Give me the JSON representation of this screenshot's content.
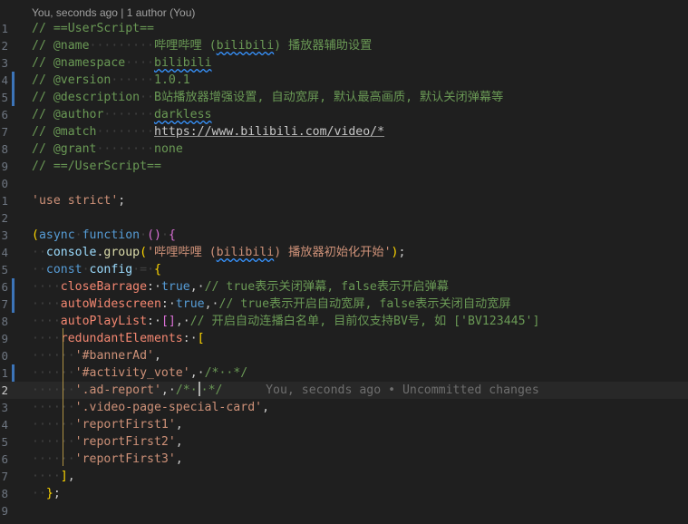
{
  "blame_header": "You, seconds ago | 1 author (You)",
  "inline_blame": "You, seconds ago • Uncommitted changes",
  "lines": [
    {
      "num": "1",
      "modified": false,
      "tokens": [
        [
          "// ",
          "c-comment"
        ],
        [
          "==UserScript==",
          "c-comment"
        ]
      ]
    },
    {
      "num": "2",
      "modified": false,
      "tokens": [
        [
          "// ",
          "c-comment"
        ],
        [
          "@name",
          "c-comment"
        ],
        [
          "·········",
          "ws"
        ],
        [
          "哔哩哔哩 (",
          "c-comment"
        ],
        [
          "bilibili",
          "c-comment squig"
        ],
        [
          ") 播放器辅助设置",
          "c-comment"
        ]
      ]
    },
    {
      "num": "3",
      "modified": false,
      "tokens": [
        [
          "// ",
          "c-comment"
        ],
        [
          "@namespace",
          "c-comment"
        ],
        [
          "····",
          "ws"
        ],
        [
          "bilibili",
          "c-comment squig"
        ]
      ]
    },
    {
      "num": "4",
      "modified": true,
      "tokens": [
        [
          "// ",
          "c-comment"
        ],
        [
          "@version",
          "c-comment"
        ],
        [
          "······",
          "ws"
        ],
        [
          "1.0.1",
          "c-comment"
        ]
      ]
    },
    {
      "num": "5",
      "modified": true,
      "tokens": [
        [
          "// ",
          "c-comment"
        ],
        [
          "@description",
          "c-comment"
        ],
        [
          "··",
          "ws"
        ],
        [
          "B站播放器增强设置, 自动宽屏, 默认最高画质, 默认关闭弹幕等",
          "c-comment"
        ]
      ]
    },
    {
      "num": "6",
      "modified": false,
      "tokens": [
        [
          "// ",
          "c-comment"
        ],
        [
          "@author",
          "c-comment"
        ],
        [
          "·······",
          "ws"
        ],
        [
          "darkless",
          "c-comment squig"
        ]
      ]
    },
    {
      "num": "7",
      "modified": false,
      "tokens": [
        [
          "// ",
          "c-comment"
        ],
        [
          "@match",
          "c-comment"
        ],
        [
          "········",
          "ws"
        ],
        [
          "https://www.bilibili.com/video/*",
          "c-url"
        ]
      ]
    },
    {
      "num": "8",
      "modified": false,
      "tokens": [
        [
          "// ",
          "c-comment"
        ],
        [
          "@grant",
          "c-comment"
        ],
        [
          "········",
          "ws"
        ],
        [
          "none",
          "c-comment"
        ]
      ]
    },
    {
      "num": "9",
      "modified": false,
      "tokens": [
        [
          "// ",
          "c-comment"
        ],
        [
          "==/UserScript==",
          "c-comment"
        ]
      ]
    },
    {
      "num": "0",
      "modified": false,
      "tokens": []
    },
    {
      "num": "1",
      "modified": false,
      "tokens": [
        [
          "'use strict'",
          "c-string"
        ],
        [
          ";",
          "c-plain"
        ]
      ]
    },
    {
      "num": "2",
      "modified": false,
      "tokens": []
    },
    {
      "num": "3",
      "modified": false,
      "tokens": [
        [
          "(",
          "c-brace"
        ],
        [
          "async",
          "c-keyword"
        ],
        [
          "·",
          "ws"
        ],
        [
          "function",
          "c-keyword"
        ],
        [
          "·",
          "ws"
        ],
        [
          "()",
          "c-bracket"
        ],
        [
          "·",
          "ws"
        ],
        [
          "{",
          "c-bracket"
        ]
      ]
    },
    {
      "num": "4",
      "modified": false,
      "tokens": [
        [
          "··",
          "ws"
        ],
        [
          "console",
          "c-ident"
        ],
        [
          ".",
          "c-plain"
        ],
        [
          "group",
          "c-func"
        ],
        [
          "(",
          "c-brace"
        ],
        [
          "'哔哩哔哩 (",
          "c-string"
        ],
        [
          "bilibili",
          "c-string squig"
        ],
        [
          ") 播放器初始化开始'",
          "c-string"
        ],
        [
          ")",
          "c-brace"
        ],
        [
          ";",
          "c-plain"
        ]
      ]
    },
    {
      "num": "5",
      "modified": false,
      "tokens": [
        [
          "··",
          "ws"
        ],
        [
          "const",
          "c-keyword"
        ],
        [
          "·",
          "ws"
        ],
        [
          "config",
          "c-ident"
        ],
        [
          "·=·",
          "ws"
        ],
        [
          "{",
          "c-brace"
        ]
      ]
    },
    {
      "num": "6",
      "modified": true,
      "tokens": [
        [
          "····",
          "ws"
        ],
        [
          "closeBarrage",
          "c-prop"
        ],
        [
          ":·",
          "c-plain"
        ],
        [
          "true",
          "c-keyword"
        ],
        [
          ",·",
          "c-plain"
        ],
        [
          "// true表示关闭弹幕, false表示开启弹幕",
          "c-comment"
        ]
      ]
    },
    {
      "num": "7",
      "modified": true,
      "tokens": [
        [
          "····",
          "ws"
        ],
        [
          "autoWidescreen",
          "c-prop"
        ],
        [
          ":·",
          "c-plain"
        ],
        [
          "true",
          "c-keyword"
        ],
        [
          ",·",
          "c-plain"
        ],
        [
          "// true表示开启自动宽屏, false表示关闭自动宽屏",
          "c-comment"
        ]
      ]
    },
    {
      "num": "8",
      "modified": false,
      "tokens": [
        [
          "····",
          "ws"
        ],
        [
          "autoPlayList",
          "c-prop"
        ],
        [
          ":·",
          "c-plain"
        ],
        [
          "[]",
          "c-bracket"
        ],
        [
          ",·",
          "c-plain"
        ],
        [
          "// 开启自动连播白名单, 目前仅支持BV号, 如 ['BV123445']",
          "c-comment"
        ]
      ]
    },
    {
      "num": "9",
      "modified": false,
      "tokens": [
        [
          "····",
          "ws"
        ],
        [
          "redundantElements",
          "c-prop"
        ],
        [
          ":·",
          "c-plain"
        ],
        [
          "[",
          "c-brace"
        ]
      ]
    },
    {
      "num": "0",
      "modified": false,
      "tokens": [
        [
          "······",
          "ws"
        ],
        [
          "'#bannerAd'",
          "c-string"
        ],
        [
          ",",
          "c-plain"
        ]
      ]
    },
    {
      "num": "1",
      "modified": true,
      "tokens": [
        [
          "······",
          "ws"
        ],
        [
          "'#activity_vote'",
          "c-string"
        ],
        [
          ",·",
          "c-plain"
        ],
        [
          "/*··*/",
          "c-comment"
        ]
      ]
    },
    {
      "num": "2",
      "modified": false,
      "current": true,
      "tokens": [
        [
          "······",
          "ws"
        ],
        [
          "'.ad-report'",
          "c-string"
        ],
        [
          ",·",
          "c-plain"
        ],
        [
          "/*·",
          "c-comment"
        ],
        [
          "CURSOR",
          "cursor"
        ],
        [
          "·*/",
          "c-comment"
        ],
        [
          "      ",
          "ws"
        ],
        [
          "BLAME",
          "blame"
        ]
      ]
    },
    {
      "num": "3",
      "modified": false,
      "tokens": [
        [
          "······",
          "ws"
        ],
        [
          "'.video-page-special-card'",
          "c-string"
        ],
        [
          ",",
          "c-plain"
        ]
      ]
    },
    {
      "num": "4",
      "modified": false,
      "tokens": [
        [
          "······",
          "ws"
        ],
        [
          "'reportFirst1'",
          "c-string"
        ],
        [
          ",",
          "c-plain"
        ]
      ]
    },
    {
      "num": "5",
      "modified": false,
      "tokens": [
        [
          "······",
          "ws"
        ],
        [
          "'reportFirst2'",
          "c-string"
        ],
        [
          ",",
          "c-plain"
        ]
      ]
    },
    {
      "num": "6",
      "modified": false,
      "tokens": [
        [
          "······",
          "ws"
        ],
        [
          "'reportFirst3'",
          "c-string"
        ],
        [
          ",",
          "c-plain"
        ]
      ]
    },
    {
      "num": "7",
      "modified": false,
      "tokens": [
        [
          "····",
          "ws"
        ],
        [
          "]",
          "c-brace"
        ],
        [
          ",",
          "c-plain"
        ]
      ]
    },
    {
      "num": "8",
      "modified": false,
      "tokens": [
        [
          "··",
          "ws"
        ],
        [
          "}",
          "c-brace"
        ],
        [
          ";",
          "c-plain"
        ]
      ]
    },
    {
      "num": "9",
      "modified": false,
      "tokens": []
    }
  ]
}
